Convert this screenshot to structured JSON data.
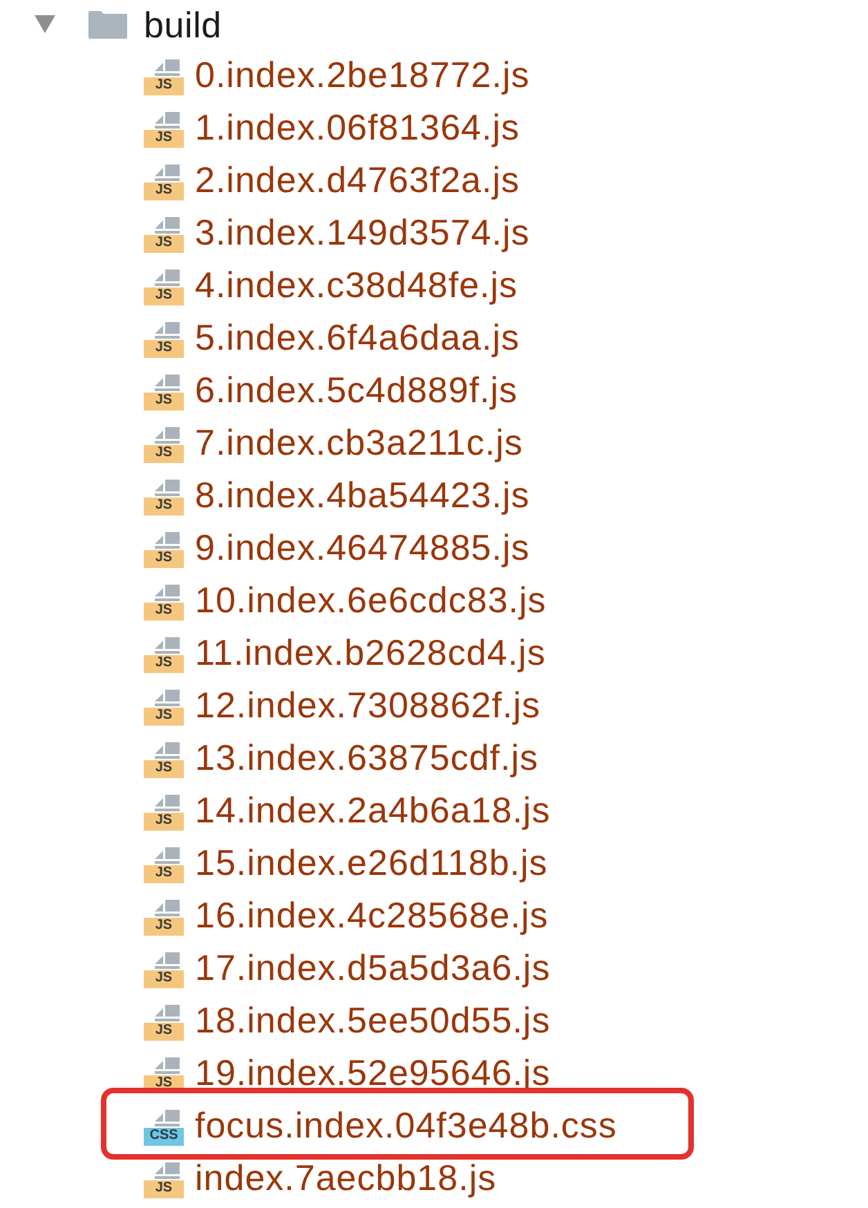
{
  "tree": {
    "name": "build",
    "expanded": true,
    "children": [
      {
        "name": "0.index.2be18772.js",
        "kind": "js",
        "badge": "JS",
        "highlighted": false
      },
      {
        "name": "1.index.06f81364.js",
        "kind": "js",
        "badge": "JS",
        "highlighted": false
      },
      {
        "name": "2.index.d4763f2a.js",
        "kind": "js",
        "badge": "JS",
        "highlighted": false
      },
      {
        "name": "3.index.149d3574.js",
        "kind": "js",
        "badge": "JS",
        "highlighted": false
      },
      {
        "name": "4.index.c38d48fe.js",
        "kind": "js",
        "badge": "JS",
        "highlighted": false
      },
      {
        "name": "5.index.6f4a6daa.js",
        "kind": "js",
        "badge": "JS",
        "highlighted": false
      },
      {
        "name": "6.index.5c4d889f.js",
        "kind": "js",
        "badge": "JS",
        "highlighted": false
      },
      {
        "name": "7.index.cb3a211c.js",
        "kind": "js",
        "badge": "JS",
        "highlighted": false
      },
      {
        "name": "8.index.4ba54423.js",
        "kind": "js",
        "badge": "JS",
        "highlighted": false
      },
      {
        "name": "9.index.46474885.js",
        "kind": "js",
        "badge": "JS",
        "highlighted": false
      },
      {
        "name": "10.index.6e6cdc83.js",
        "kind": "js",
        "badge": "JS",
        "highlighted": false
      },
      {
        "name": "11.index.b2628cd4.js",
        "kind": "js",
        "badge": "JS",
        "highlighted": false
      },
      {
        "name": "12.index.7308862f.js",
        "kind": "js",
        "badge": "JS",
        "highlighted": false
      },
      {
        "name": "13.index.63875cdf.js",
        "kind": "js",
        "badge": "JS",
        "highlighted": false
      },
      {
        "name": "14.index.2a4b6a18.js",
        "kind": "js",
        "badge": "JS",
        "highlighted": false
      },
      {
        "name": "15.index.e26d118b.js",
        "kind": "js",
        "badge": "JS",
        "highlighted": false
      },
      {
        "name": "16.index.4c28568e.js",
        "kind": "js",
        "badge": "JS",
        "highlighted": false
      },
      {
        "name": "17.index.d5a5d3a6.js",
        "kind": "js",
        "badge": "JS",
        "highlighted": false
      },
      {
        "name": "18.index.5ee50d55.js",
        "kind": "js",
        "badge": "JS",
        "highlighted": false
      },
      {
        "name": "19.index.52e95646.js",
        "kind": "js",
        "badge": "JS",
        "highlighted": false
      },
      {
        "name": "focus.index.04f3e48b.css",
        "kind": "css",
        "badge": "CSS",
        "highlighted": true
      },
      {
        "name": "index.7aecbb18.js",
        "kind": "js",
        "badge": "JS",
        "highlighted": false
      }
    ]
  }
}
